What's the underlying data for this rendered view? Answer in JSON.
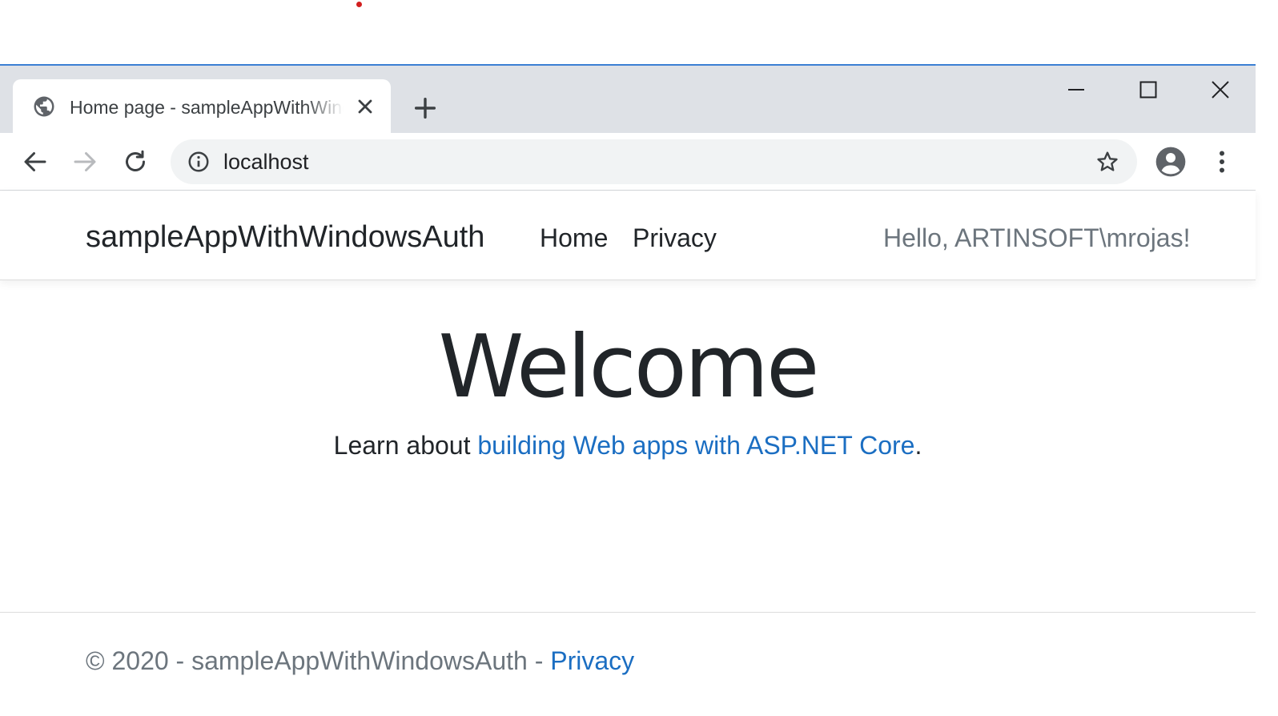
{
  "tab": {
    "title": "Home page - sampleAppWithWindowsAuth"
  },
  "toolbar": {
    "url": "localhost"
  },
  "navbar": {
    "brand": "sampleAppWithWindowsAuth",
    "links": [
      {
        "label": "Home"
      },
      {
        "label": "Privacy"
      }
    ],
    "greeting": "Hello, ARTINSOFT\\mrojas!"
  },
  "main": {
    "heading": "Welcome",
    "lead_prefix": "Learn about ",
    "lead_link": "building Web apps with ASP.NET Core",
    "lead_suffix": "."
  },
  "footer": {
    "copyright": "© 2020 - sampleAppWithWindowsAuth - ",
    "privacy_link": "Privacy"
  },
  "colors": {
    "accent": "#1b6ec2",
    "tabstrip": "#dee1e6",
    "window_border": "#3b7fd4",
    "muted_text": "#6c757d"
  },
  "icons": [
    "globe-icon",
    "close-icon",
    "plus-icon",
    "minimize-icon",
    "maximize-icon",
    "window-close-icon",
    "back-arrow-icon",
    "forward-arrow-icon",
    "reload-icon",
    "info-icon",
    "star-icon",
    "profile-icon",
    "more-vert-icon"
  ]
}
